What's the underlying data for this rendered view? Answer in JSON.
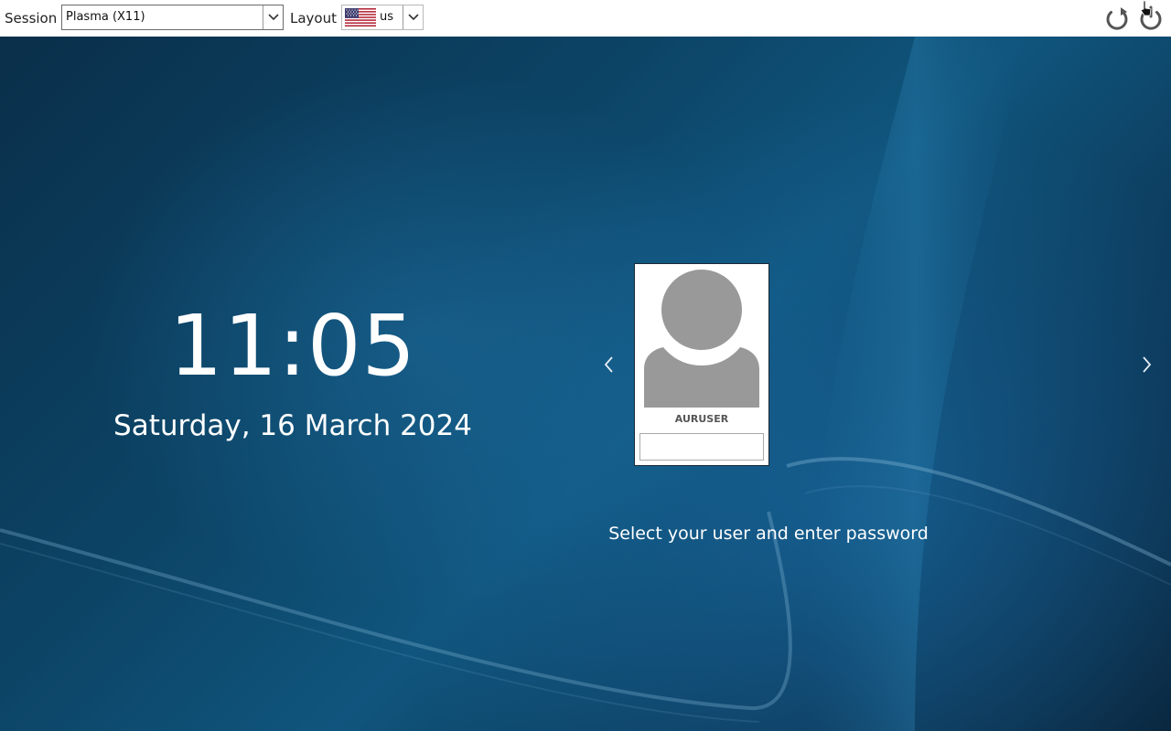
{
  "topbar": {
    "session_label": "Session",
    "session_value": "Plasma (X11)",
    "layout_label": "Layout",
    "layout_value": "us",
    "layout_flag_icon": "us-flag-icon",
    "restart_icon": "restart-icon",
    "shutdown_icon": "shutdown-icon"
  },
  "clock": {
    "time": "11:05",
    "date": "Saturday, 16 March 2024"
  },
  "user_selector": {
    "username": "AURUSER",
    "password_value": "",
    "prev_icon": "chevron-left-icon",
    "next_icon": "chevron-right-icon"
  },
  "prompt": "Select your user and enter password",
  "colors": {
    "background_dark": "#0a2f4a",
    "background_mid": "#10557d",
    "avatar_gray": "#999999",
    "topbar": "#ffffff"
  }
}
